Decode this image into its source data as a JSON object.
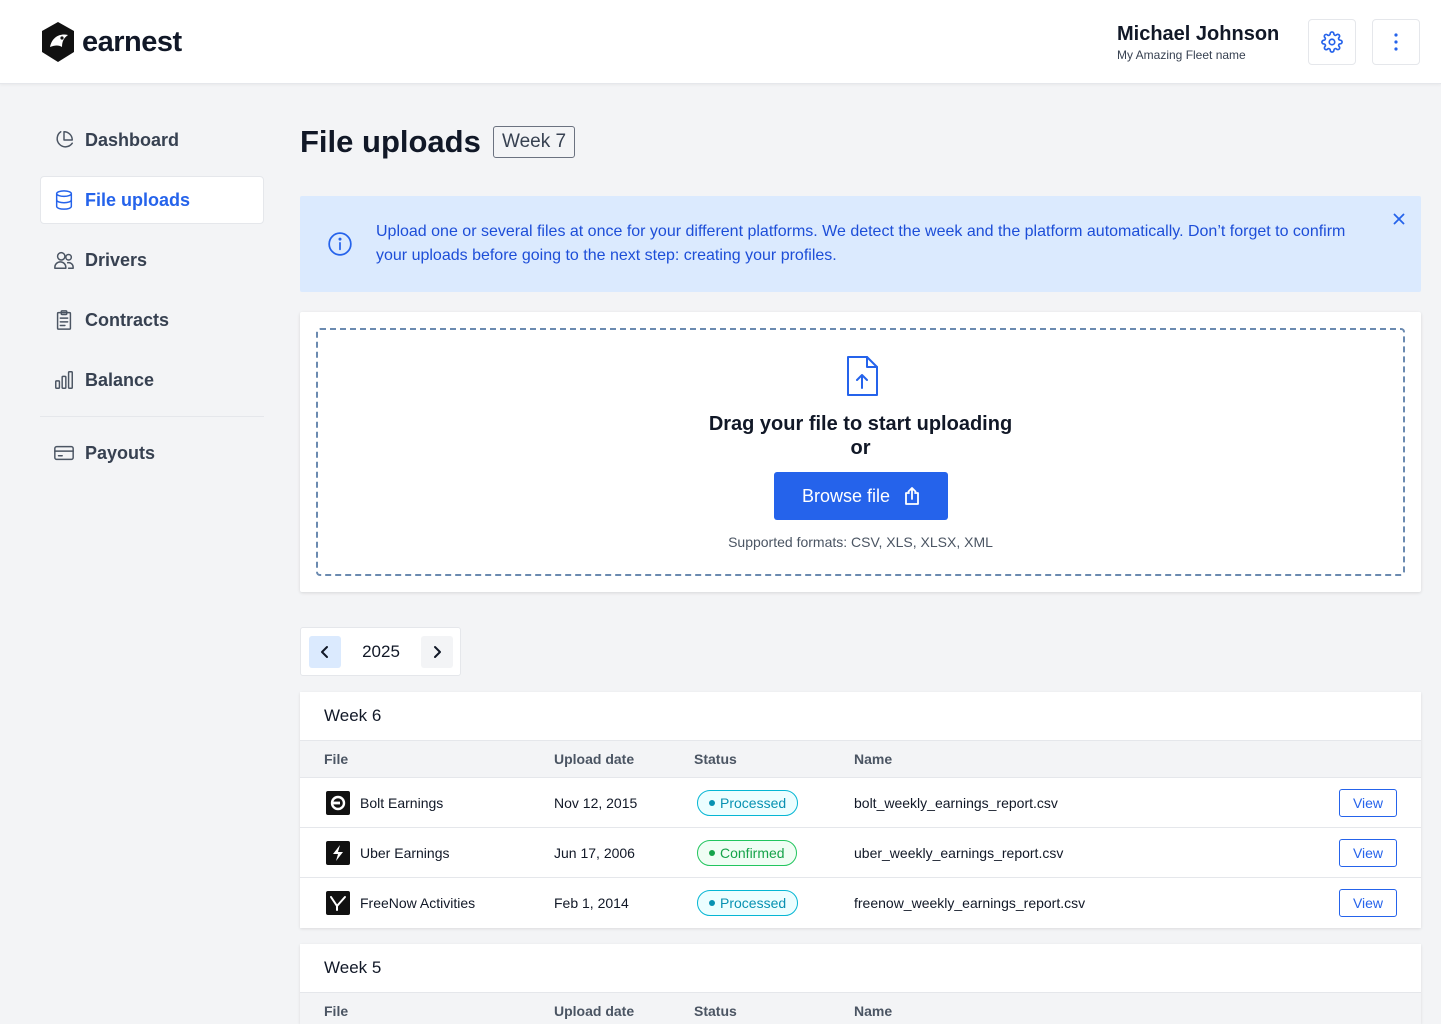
{
  "header": {
    "brand": "earnest",
    "user_name": "Michael Johnson",
    "fleet_name": "My Amazing Fleet name",
    "settings_icon": "gear-icon",
    "menu_icon": "more-vertical-icon"
  },
  "sidebar": {
    "items": [
      {
        "label": "Dashboard",
        "icon": "pie-chart-icon"
      },
      {
        "label": "File uploads",
        "icon": "database-icon",
        "active": true
      },
      {
        "label": "Drivers",
        "icon": "users-icon"
      },
      {
        "label": "Contracts",
        "icon": "clipboard-icon"
      },
      {
        "label": "Balance",
        "icon": "bar-chart-icon"
      },
      {
        "label": "Payouts",
        "icon": "credit-card-icon"
      }
    ]
  },
  "page": {
    "title": "File uploads",
    "week_badge": "Week 7"
  },
  "info_banner": {
    "text": "Upload one or several files at once for your different platforms. We detect the week and the platform automatically. Don’t forget to confirm your uploads before going to the next step: creating your profiles."
  },
  "upload": {
    "title": "Drag your file to start uploading",
    "or": "or",
    "button_label": "Browse file",
    "formats": "Supported formats: CSV, XLS, XLSX, XML"
  },
  "year_picker": {
    "year": "2025"
  },
  "table_headers": {
    "file": "File",
    "upload_date": "Upload date",
    "status": "Status",
    "name": "Name"
  },
  "weeks": [
    {
      "title": "Week 6",
      "rows": [
        {
          "file": "Bolt Earnings",
          "date": "Nov 12, 2015",
          "status": "Processed",
          "name": "bolt_weekly_earnings_report.csv",
          "action": "View"
        },
        {
          "file": "Uber Earnings",
          "date": "Jun 17, 2006",
          "status": "Confirmed",
          "name": "uber_weekly_earnings_report.csv",
          "action": "View"
        },
        {
          "file": "FreeNow Activities",
          "date": "Feb 1, 2014",
          "status": "Processed",
          "name": "freenow_weekly_earnings_report.csv",
          "action": "View"
        }
      ]
    },
    {
      "title": "Week 5",
      "rows": []
    }
  ],
  "colors": {
    "primary": "#2563eb",
    "info_bg": "#dbeafe",
    "processed": "#0891b2",
    "confirmed": "#16a34a"
  }
}
